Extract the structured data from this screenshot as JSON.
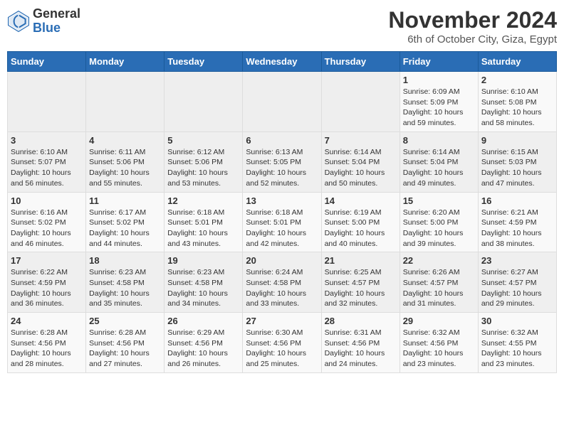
{
  "header": {
    "logo": {
      "line1": "General",
      "line2": "Blue"
    },
    "title": "November 2024",
    "subtitle": "6th of October City, Giza, Egypt"
  },
  "days_of_week": [
    "Sunday",
    "Monday",
    "Tuesday",
    "Wednesday",
    "Thursday",
    "Friday",
    "Saturday"
  ],
  "weeks": [
    [
      {
        "day": "",
        "content": ""
      },
      {
        "day": "",
        "content": ""
      },
      {
        "day": "",
        "content": ""
      },
      {
        "day": "",
        "content": ""
      },
      {
        "day": "",
        "content": ""
      },
      {
        "day": "1",
        "content": "Sunrise: 6:09 AM\nSunset: 5:09 PM\nDaylight: 10 hours and 59 minutes."
      },
      {
        "day": "2",
        "content": "Sunrise: 6:10 AM\nSunset: 5:08 PM\nDaylight: 10 hours and 58 minutes."
      }
    ],
    [
      {
        "day": "3",
        "content": "Sunrise: 6:10 AM\nSunset: 5:07 PM\nDaylight: 10 hours and 56 minutes."
      },
      {
        "day": "4",
        "content": "Sunrise: 6:11 AM\nSunset: 5:06 PM\nDaylight: 10 hours and 55 minutes."
      },
      {
        "day": "5",
        "content": "Sunrise: 6:12 AM\nSunset: 5:06 PM\nDaylight: 10 hours and 53 minutes."
      },
      {
        "day": "6",
        "content": "Sunrise: 6:13 AM\nSunset: 5:05 PM\nDaylight: 10 hours and 52 minutes."
      },
      {
        "day": "7",
        "content": "Sunrise: 6:14 AM\nSunset: 5:04 PM\nDaylight: 10 hours and 50 minutes."
      },
      {
        "day": "8",
        "content": "Sunrise: 6:14 AM\nSunset: 5:04 PM\nDaylight: 10 hours and 49 minutes."
      },
      {
        "day": "9",
        "content": "Sunrise: 6:15 AM\nSunset: 5:03 PM\nDaylight: 10 hours and 47 minutes."
      }
    ],
    [
      {
        "day": "10",
        "content": "Sunrise: 6:16 AM\nSunset: 5:02 PM\nDaylight: 10 hours and 46 minutes."
      },
      {
        "day": "11",
        "content": "Sunrise: 6:17 AM\nSunset: 5:02 PM\nDaylight: 10 hours and 44 minutes."
      },
      {
        "day": "12",
        "content": "Sunrise: 6:18 AM\nSunset: 5:01 PM\nDaylight: 10 hours and 43 minutes."
      },
      {
        "day": "13",
        "content": "Sunrise: 6:18 AM\nSunset: 5:01 PM\nDaylight: 10 hours and 42 minutes."
      },
      {
        "day": "14",
        "content": "Sunrise: 6:19 AM\nSunset: 5:00 PM\nDaylight: 10 hours and 40 minutes."
      },
      {
        "day": "15",
        "content": "Sunrise: 6:20 AM\nSunset: 5:00 PM\nDaylight: 10 hours and 39 minutes."
      },
      {
        "day": "16",
        "content": "Sunrise: 6:21 AM\nSunset: 4:59 PM\nDaylight: 10 hours and 38 minutes."
      }
    ],
    [
      {
        "day": "17",
        "content": "Sunrise: 6:22 AM\nSunset: 4:59 PM\nDaylight: 10 hours and 36 minutes."
      },
      {
        "day": "18",
        "content": "Sunrise: 6:23 AM\nSunset: 4:58 PM\nDaylight: 10 hours and 35 minutes."
      },
      {
        "day": "19",
        "content": "Sunrise: 6:23 AM\nSunset: 4:58 PM\nDaylight: 10 hours and 34 minutes."
      },
      {
        "day": "20",
        "content": "Sunrise: 6:24 AM\nSunset: 4:58 PM\nDaylight: 10 hours and 33 minutes."
      },
      {
        "day": "21",
        "content": "Sunrise: 6:25 AM\nSunset: 4:57 PM\nDaylight: 10 hours and 32 minutes."
      },
      {
        "day": "22",
        "content": "Sunrise: 6:26 AM\nSunset: 4:57 PM\nDaylight: 10 hours and 31 minutes."
      },
      {
        "day": "23",
        "content": "Sunrise: 6:27 AM\nSunset: 4:57 PM\nDaylight: 10 hours and 29 minutes."
      }
    ],
    [
      {
        "day": "24",
        "content": "Sunrise: 6:28 AM\nSunset: 4:56 PM\nDaylight: 10 hours and 28 minutes."
      },
      {
        "day": "25",
        "content": "Sunrise: 6:28 AM\nSunset: 4:56 PM\nDaylight: 10 hours and 27 minutes."
      },
      {
        "day": "26",
        "content": "Sunrise: 6:29 AM\nSunset: 4:56 PM\nDaylight: 10 hours and 26 minutes."
      },
      {
        "day": "27",
        "content": "Sunrise: 6:30 AM\nSunset: 4:56 PM\nDaylight: 10 hours and 25 minutes."
      },
      {
        "day": "28",
        "content": "Sunrise: 6:31 AM\nSunset: 4:56 PM\nDaylight: 10 hours and 24 minutes."
      },
      {
        "day": "29",
        "content": "Sunrise: 6:32 AM\nSunset: 4:56 PM\nDaylight: 10 hours and 23 minutes."
      },
      {
        "day": "30",
        "content": "Sunrise: 6:32 AM\nSunset: 4:55 PM\nDaylight: 10 hours and 23 minutes."
      }
    ]
  ]
}
